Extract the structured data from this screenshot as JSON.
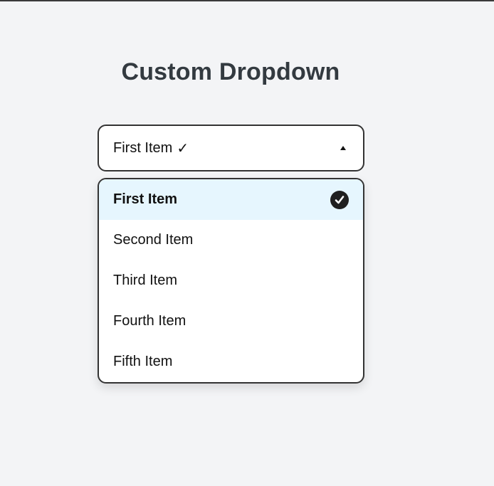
{
  "heading": "Custom Dropdown",
  "dropdown": {
    "selected_label": "First Item",
    "selected_mark": "✓",
    "caret_icon": "caret-up-icon",
    "options": [
      {
        "label": "First Item",
        "selected": true
      },
      {
        "label": "Second Item",
        "selected": false
      },
      {
        "label": "Third Item",
        "selected": false
      },
      {
        "label": "Fourth Item",
        "selected": false
      },
      {
        "label": "Fifth Item",
        "selected": false
      }
    ],
    "selected_icon": "check-circle-icon"
  },
  "colors": {
    "background": "#f3f4f6",
    "selected_option_bg": "#e6f6fe",
    "border": "#333333",
    "check_badge": "#1f1f1f"
  }
}
